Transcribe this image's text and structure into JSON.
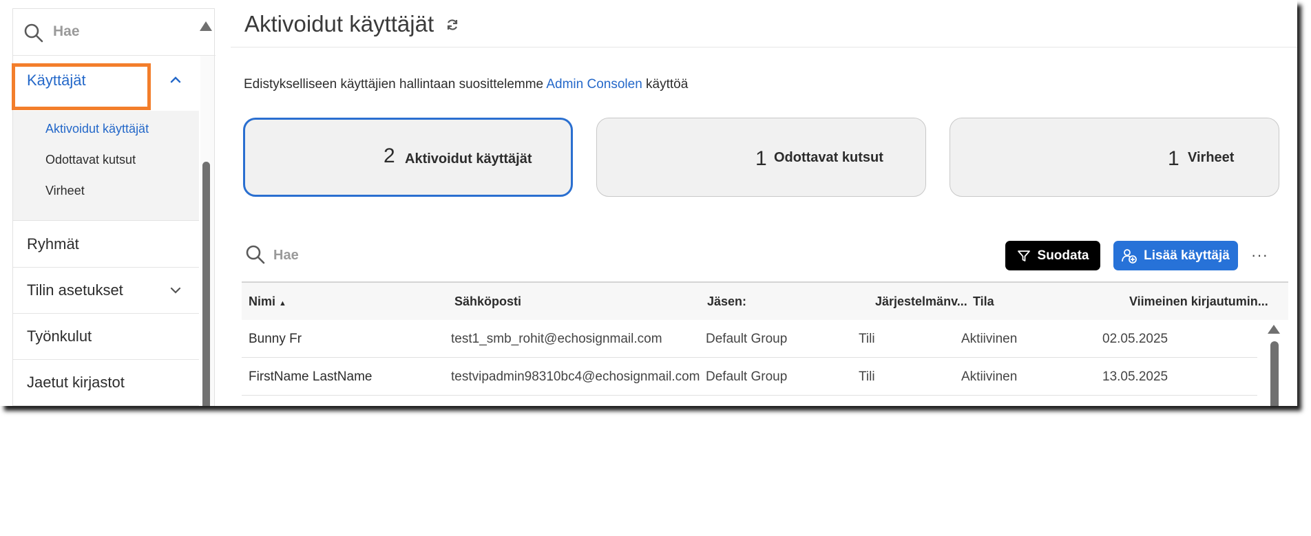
{
  "sidebar": {
    "search_placeholder": "Hae",
    "users": {
      "label": "Käyttäjät",
      "children": [
        "Aktivoidut käyttäjät",
        "Odottavat kutsut",
        "Virheet"
      ]
    },
    "items": [
      {
        "label": "Ryhmät"
      },
      {
        "label": "Tilin asetukset"
      },
      {
        "label": "Työnkulut"
      },
      {
        "label": "Jaetut kirjastot"
      }
    ]
  },
  "main": {
    "title": "Aktivoidut käyttäjät",
    "info": {
      "before": "Edistykselliseen käyttäjien hallintaan suosittelemme",
      "link": "Admin Consolen",
      "after": "käyttöä"
    },
    "cards": [
      {
        "count": "2",
        "label": "Aktivoidut käyttäjät"
      },
      {
        "count": "1",
        "label": "Odottavat kutsut"
      },
      {
        "count": "1",
        "label": "Virheet"
      }
    ],
    "table_search_placeholder": "Hae",
    "filter_label": "Suodata",
    "add_user_label": "Lisää käyttäjä",
    "more_label": "···",
    "columns": [
      "Nimi",
      "Sähköposti",
      "Jäsen:",
      "Järjestelmänv...",
      "Tila",
      "Viimeinen kirjautumin..."
    ],
    "sort_indicator": "▲",
    "rows": [
      [
        "Bunny Fr",
        "test1_smb_rohit@echosignmail.com",
        "Default Group",
        "Tili",
        "Aktiivinen",
        "02.05.2025"
      ],
      [
        "FirstName LastName",
        "testvipadmin98310bc4@echosignmail.com",
        "Default Group",
        "Tili",
        "Aktiivinen",
        "13.05.2025"
      ]
    ]
  },
  "colors": {
    "accent": "#2468c9",
    "highlight": "#f37e2b",
    "primary_button": "#2772d8"
  }
}
